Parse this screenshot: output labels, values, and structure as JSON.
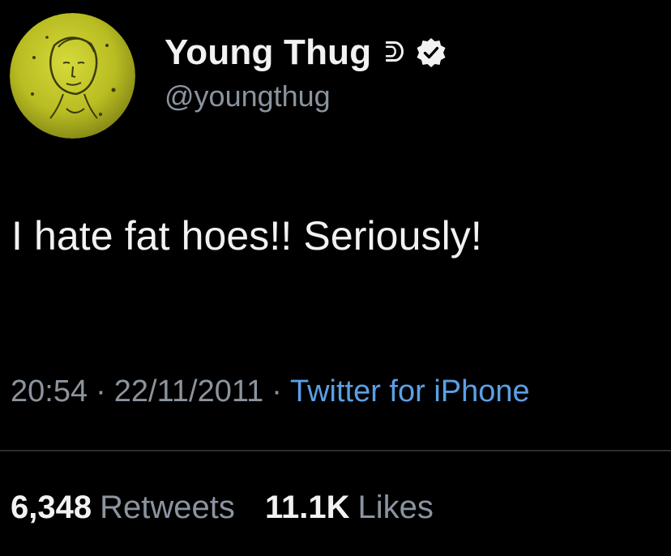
{
  "tweet": {
    "author": {
      "display_name": "Young Thug",
      "name_glyph": "ᕲ",
      "handle": "@youngthug",
      "verified_icon": "verified-badge-icon",
      "avatar_icon": "profile-avatar"
    },
    "text": "I hate fat hoes!! Seriously!",
    "time": "20:54",
    "separator": "·",
    "date": "22/11/2011",
    "source": "Twitter for iPhone",
    "stats": {
      "retweets_count": "6,348",
      "retweets_label": "Retweets",
      "likes_count": "11.1K",
      "likes_label": "Likes"
    }
  },
  "colors": {
    "background": "#000000",
    "primary_text": "#f2f2f2",
    "secondary_text": "#8b949e",
    "link": "#5aa0e6",
    "divider": "#2a2d31",
    "avatar_fill": "#c2c62a"
  }
}
